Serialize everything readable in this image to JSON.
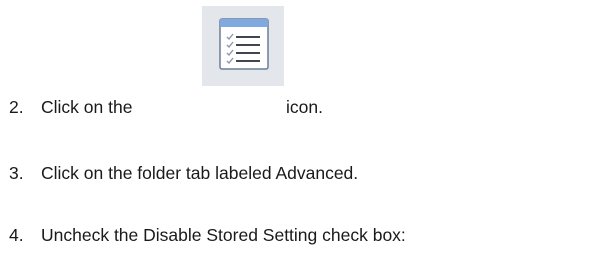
{
  "steps": [
    {
      "number": "2.",
      "text_before_icon": "Click on the",
      "icon": "settings-list-icon",
      "text_after_icon": "icon."
    },
    {
      "number": "3.",
      "text": "Click on the folder tab labeled Advanced."
    },
    {
      "number": "4.",
      "text": "Uncheck the Disable Stored Setting check box:"
    }
  ],
  "colors": {
    "text": "#1a1a1a",
    "icon_bg": "#e3e6ea",
    "icon_header": "#7fa9df",
    "icon_border": "#6d7f98"
  }
}
